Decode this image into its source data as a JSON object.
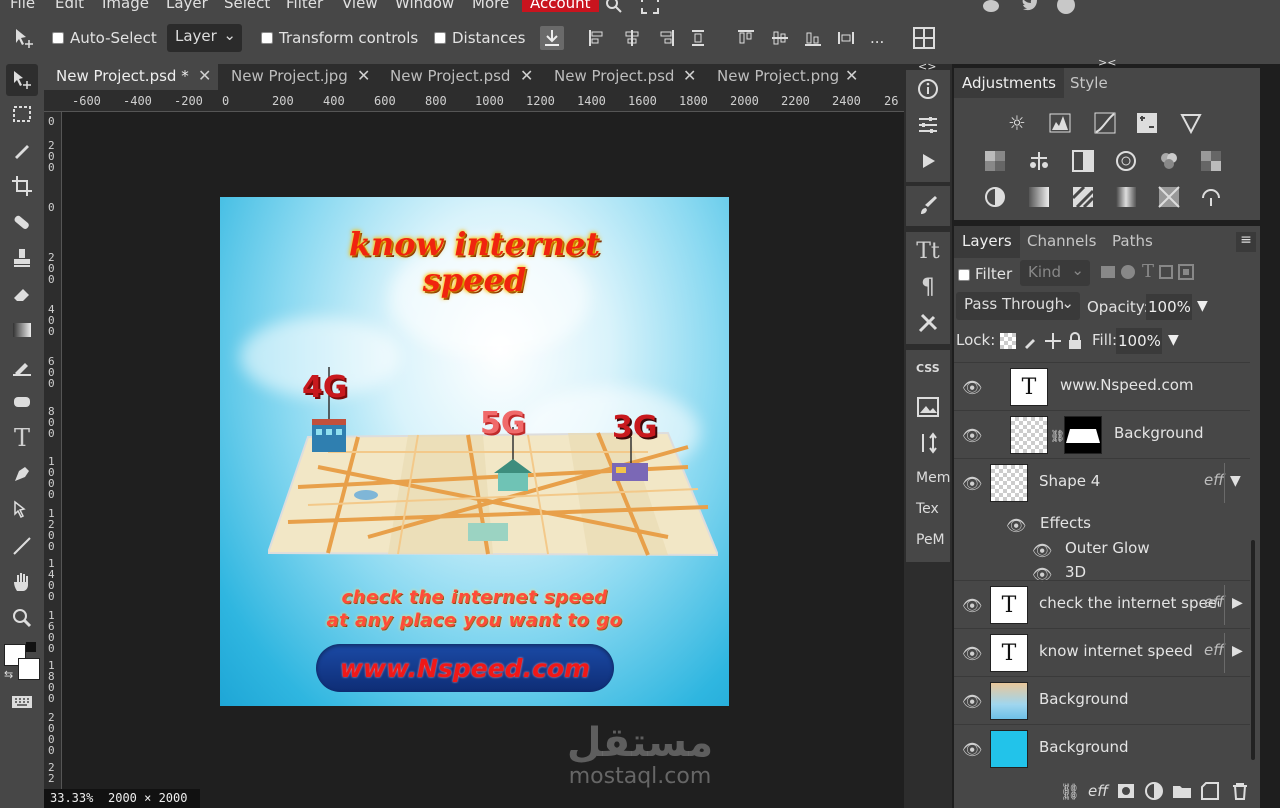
{
  "menu": {
    "items": [
      "File",
      "Edit",
      "Image",
      "Layer",
      "Select",
      "Filter",
      "View",
      "Window",
      "More"
    ],
    "account_label": "Account"
  },
  "options": {
    "auto_select_label": "Auto-Select",
    "auto_select_mode": "Layer",
    "transform_controls_label": "Transform controls",
    "distances_label": "Distances",
    "more_label": "..."
  },
  "tabs": [
    {
      "label": "New Project.psd *",
      "active": true
    },
    {
      "label": "New Project.jpg"
    },
    {
      "label": "New Project.psd"
    },
    {
      "label": "New Project.psd"
    },
    {
      "label": "New Project.png"
    }
  ],
  "ruler_h": [
    "-600",
    "-400",
    "-200",
    "0",
    "200",
    "400",
    "600",
    "800",
    "1000",
    "1200",
    "1400",
    "1600",
    "1800",
    "2000",
    "2200",
    "2400",
    "26"
  ],
  "ruler_v": [
    "0",
    "200",
    "400",
    "600",
    "800",
    "1000",
    "1200",
    "1400",
    "1600",
    "1800",
    "2000",
    "22"
  ],
  "artwork": {
    "title_line1": "know internet",
    "title_line2": "speed",
    "label_4g": "4G",
    "label_5g": "5G",
    "label_3g": "3G",
    "subtitle_line1": "check the internet speed",
    "subtitle_line2": "at any place you want to go",
    "url": "www.Nspeed.com"
  },
  "status": {
    "zoom": "33.33%",
    "size": "2000 × 2000"
  },
  "watermark": {
    "arabic": "مستقل",
    "latin": "mostaql.com"
  },
  "midcol": {
    "mem": "Mem",
    "tex": "Tex",
    "pem": "PeM",
    "css": "CSS"
  },
  "adjustments": {
    "tab_adjustments": "Adjustments",
    "tab_style": "Style"
  },
  "layers": {
    "tab_layers": "Layers",
    "tab_channels": "Channels",
    "tab_paths": "Paths",
    "filter_label": "Filter",
    "kind_label": "Kind",
    "blend_mode": "Pass Through",
    "opacity_label": "Opacity:",
    "opacity_value": "100%",
    "lock_label": "Lock:",
    "fill_label": "Fill:",
    "fill_value": "100%",
    "eff": "eff",
    "rows": [
      {
        "name": "www.Nspeed.com"
      },
      {
        "name": "Background"
      },
      {
        "name": "Shape 4"
      },
      {
        "name": "Effects"
      },
      {
        "name": "Outer Glow"
      },
      {
        "name": "3D"
      },
      {
        "name": "check the internet speed"
      },
      {
        "name": "know internet speed"
      },
      {
        "name": "Background"
      },
      {
        "name": "Background"
      }
    ]
  },
  "colors": {
    "accent_red": "#c9141e",
    "panel": "#474747",
    "dark": "#2d2d2d"
  }
}
